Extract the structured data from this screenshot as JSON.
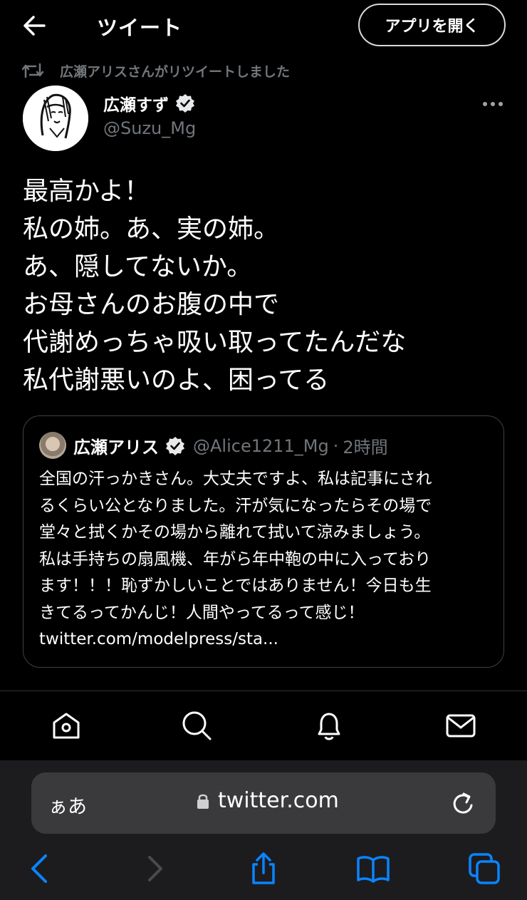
{
  "header": {
    "title": "ツイート",
    "open_app_label": "アプリを開く"
  },
  "retweet": {
    "text": "広瀬アリスさんがリツイートしました"
  },
  "author": {
    "name": "広瀬すず",
    "handle": "@Suzu_Mg"
  },
  "tweet": {
    "lines": [
      "最高かよ！",
      "私の姉。あ、実の姉。",
      "あ、隠してないか。",
      "お母さんのお腹の中で",
      "代謝めっちゃ吸い取ってたんだな",
      "私代謝悪いのよ、困ってる"
    ]
  },
  "quote": {
    "name": "広瀬アリス",
    "handle": "@Alice1211_Mg",
    "separator": "·",
    "time": "2時間",
    "lines": [
      "全国の汗っかきさん。大丈夫ですよ、私は記事にされ",
      "るくらい公となりました。汗が気になったらその場で",
      "堂々と拭くかその場から離れて拭いて涼みましょう。",
      "私は手持ちの扇風機、年がら年中鞄の中に入っており",
      "ます！！！恥ずかしいことではありません！今日も生",
      "きてるってかんじ！人間やってるって感じ！",
      "twitter.com/modelpress/sta..."
    ]
  },
  "tabbar": {
    "icons": [
      "home-icon",
      "search-icon",
      "bell-icon",
      "mail-icon"
    ]
  },
  "safari": {
    "aa_label": "ぁあ",
    "url": "twitter.com"
  },
  "colors": {
    "background": "#000000",
    "text": "#ffffff",
    "secondary": "#71767b",
    "safari_accent": "#0a84ff",
    "url_bar": "#3a3a3c"
  }
}
